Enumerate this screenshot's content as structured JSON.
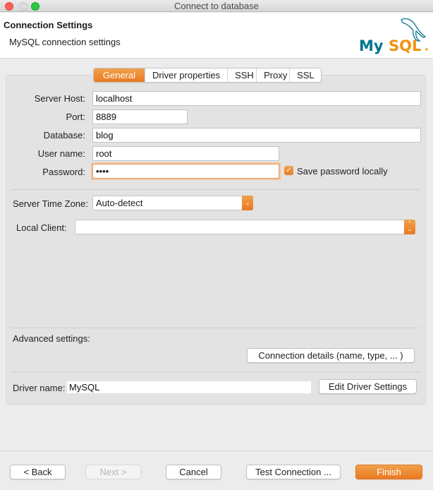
{
  "window": {
    "title": "Connect to database"
  },
  "header": {
    "title": "Connection Settings",
    "subtitle": "MySQL connection settings",
    "logo": {
      "text_my": "My",
      "text_sql": "SQL",
      "icon": "mysql-dolphin-logo",
      "color_my": "#00758f",
      "color_sql": "#f29111"
    }
  },
  "tabs": [
    {
      "label": "General",
      "active": true
    },
    {
      "label": "Driver properties",
      "active": false
    },
    {
      "label": "SSH",
      "active": false
    },
    {
      "label": "Proxy",
      "active": false
    },
    {
      "label": "SSL",
      "active": false
    }
  ],
  "form": {
    "server_host": {
      "label": "Server Host:",
      "value": "localhost"
    },
    "port": {
      "label": "Port:",
      "value": "8889"
    },
    "database": {
      "label": "Database:",
      "value": "blog"
    },
    "user_name": {
      "label": "User name:",
      "value": "root"
    },
    "password": {
      "label": "Password:",
      "value": "••••"
    },
    "save_password": {
      "label": "Save password locally",
      "checked": true
    },
    "server_time_zone": {
      "label": "Server Time Zone:",
      "value": "Auto-detect"
    },
    "local_client": {
      "label": "Local Client:",
      "value": ""
    }
  },
  "advanced": {
    "label": "Advanced settings:",
    "connection_details_button": "Connection details (name, type, ... )"
  },
  "driver": {
    "label": "Driver name:",
    "value": "MySQL",
    "edit_button": "Edit Driver Settings"
  },
  "footer": {
    "back": "< Back",
    "next": "Next >",
    "cancel": "Cancel",
    "test": "Test Connection ...",
    "finish": "Finish"
  },
  "colors": {
    "accent": "#ea7a21"
  }
}
